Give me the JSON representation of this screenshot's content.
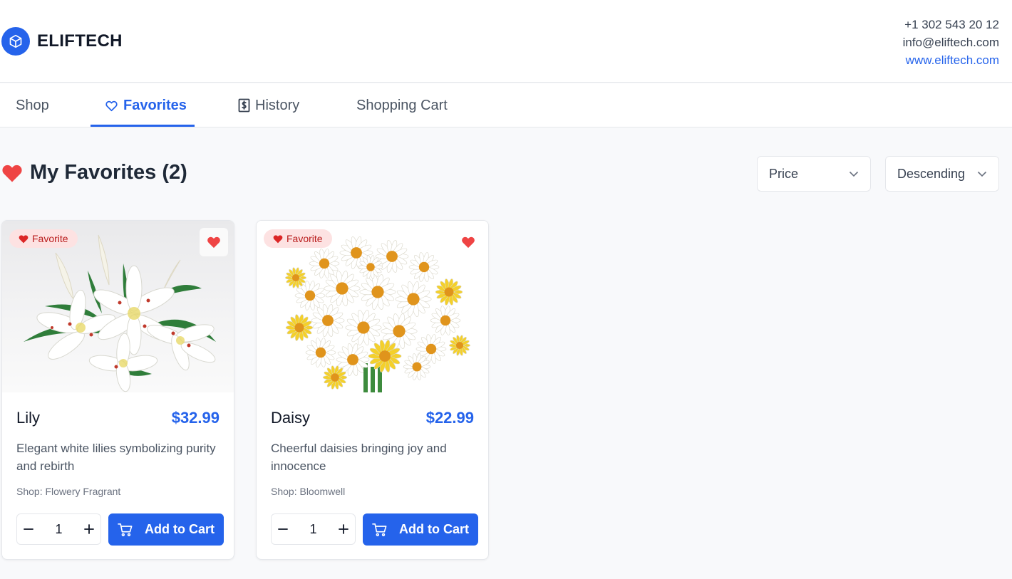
{
  "brand": {
    "name": "ELIFTECH"
  },
  "contact": {
    "phone": "+1 302 543 20 12",
    "email": "info@eliftech.com",
    "website": "www.eliftech.com"
  },
  "nav": {
    "tabs": [
      {
        "label": "Shop",
        "icon": "none",
        "active": false
      },
      {
        "label": "Favorites",
        "icon": "heart-outline-icon",
        "active": true
      },
      {
        "label": "History",
        "icon": "receipt-dollar-icon",
        "active": false
      },
      {
        "label": "Shopping Cart",
        "icon": "none",
        "active": false
      }
    ]
  },
  "page": {
    "title": "My Favorites (2)",
    "title_icon": "heart-icon"
  },
  "sort": {
    "field": "Price",
    "order": "Descending"
  },
  "colors": {
    "accent": "#2563eb",
    "heart": "#ef4444",
    "badge_bg": "#fde2e2"
  },
  "products": [
    {
      "badge": "Favorite",
      "name": "Lily",
      "price": "$32.99",
      "description": "Elegant white lilies symbolizing purity and rebirth",
      "shop": "Shop: Flowery Fragrant",
      "quantity": "1",
      "add_label": "Add to Cart",
      "image": "white-lilies-bouquet"
    },
    {
      "badge": "Favorite",
      "name": "Daisy",
      "price": "$22.99",
      "description": "Cheerful daisies bringing joy and innocence",
      "shop": "Shop: Bloomwell",
      "quantity": "1",
      "add_label": "Add to Cart",
      "image": "daisies-bouquet"
    }
  ]
}
